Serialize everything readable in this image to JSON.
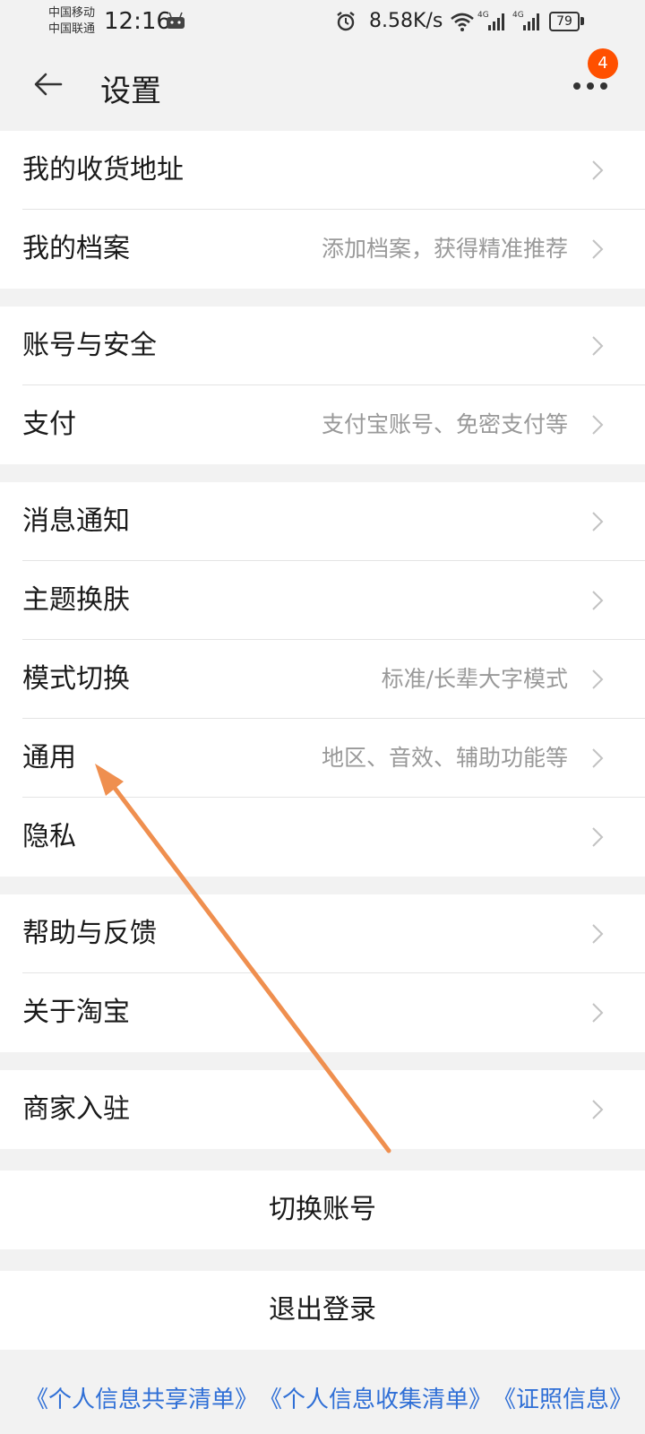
{
  "status_bar": {
    "carrier_1": "中国移动",
    "carrier_2": "中国联通",
    "time": "12:16",
    "net_speed": "8.58K/s",
    "signal_1": "4G",
    "signal_2": "4G",
    "battery": "79"
  },
  "header": {
    "title": "设置",
    "badge_count": "4"
  },
  "groups": [
    [
      {
        "label": "我的收货地址",
        "hint": ""
      },
      {
        "label": "我的档案",
        "hint": "添加档案，获得精准推荐"
      }
    ],
    [
      {
        "label": "账号与安全",
        "hint": ""
      },
      {
        "label": "支付",
        "hint": "支付宝账号、免密支付等"
      }
    ],
    [
      {
        "label": "消息通知",
        "hint": ""
      },
      {
        "label": "主题换肤",
        "hint": ""
      },
      {
        "label": "模式切换",
        "hint": "标准/长辈大字模式"
      },
      {
        "label": "通用",
        "hint": "地区、音效、辅助功能等"
      },
      {
        "label": "隐私",
        "hint": ""
      }
    ],
    [
      {
        "label": "帮助与反馈",
        "hint": ""
      },
      {
        "label": "关于淘宝",
        "hint": ""
      }
    ],
    [
      {
        "label": "商家入驻",
        "hint": ""
      }
    ]
  ],
  "actions": {
    "switch_account": "切换账号",
    "logout": "退出登录"
  },
  "footer_links": [
    "《个人信息共享清单》",
    "《个人信息收集清单》",
    "《证照信息》"
  ],
  "colors": {
    "accent": "#ff5000",
    "link": "#2f6fd6",
    "annotation_arrow": "#ef8f4f"
  }
}
